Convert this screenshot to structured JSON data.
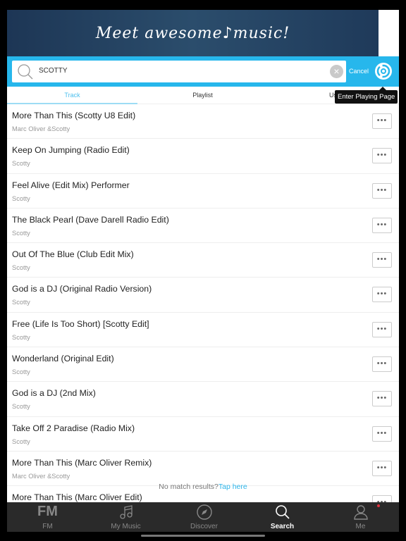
{
  "banner": {
    "text": "Meet awesome♪music!"
  },
  "search": {
    "value": "SCOTTY",
    "cancel_label": "Cancel"
  },
  "tabs": [
    {
      "label": "Track",
      "active": true
    },
    {
      "label": "Playlist"
    },
    {
      "label": "Us"
    }
  ],
  "tooltip": "Enter Playing Page",
  "tracks": [
    {
      "title": "More Than This (Scotty U8 Edit)",
      "artist": "Marc Oliver &Scotty"
    },
    {
      "title": "Keep On Jumping (Radio Edit)",
      "artist": "Scotty"
    },
    {
      "title": "Feel Alive (Edit Mix) Performer",
      "artist": "Scotty"
    },
    {
      "title": "The Black Pearl (Dave Darell Radio Edit)",
      "artist": "Scotty"
    },
    {
      "title": "Out Of The Blue (Club Edit Mix)",
      "artist": "Scotty"
    },
    {
      "title": "God is a DJ (Original Radio Version)",
      "artist": "Scotty"
    },
    {
      "title": "Free (Life Is Too Short) [Scotty Edit]",
      "artist": "Scotty"
    },
    {
      "title": "Wonderland (Original Edit)",
      "artist": "Scotty"
    },
    {
      "title": "God is a DJ (2nd Mix)",
      "artist": "Scotty"
    },
    {
      "title": "Take Off 2 Paradise (Radio Mix)",
      "artist": "Scotty"
    },
    {
      "title": "More Than This (Marc Oliver Remix)",
      "artist": "Marc Oliver &Scotty"
    },
    {
      "title": "More Than This (Marc Oliver Edit)",
      "artist": ""
    }
  ],
  "more_label": "•••",
  "no_match": {
    "text": "No match results?",
    "link": "Tap here"
  },
  "tabbar": [
    {
      "label": "FM",
      "icon": "fm-icon"
    },
    {
      "label": "My Music",
      "icon": "music-note-icon"
    },
    {
      "label": "Discover",
      "icon": "compass-icon"
    },
    {
      "label": "Search",
      "icon": "search-icon",
      "active": true
    },
    {
      "label": "Me",
      "icon": "person-icon"
    }
  ],
  "colors": {
    "accent": "#27b7ec",
    "tabbar": "#2a2a2a",
    "badge": "#e0303c"
  }
}
